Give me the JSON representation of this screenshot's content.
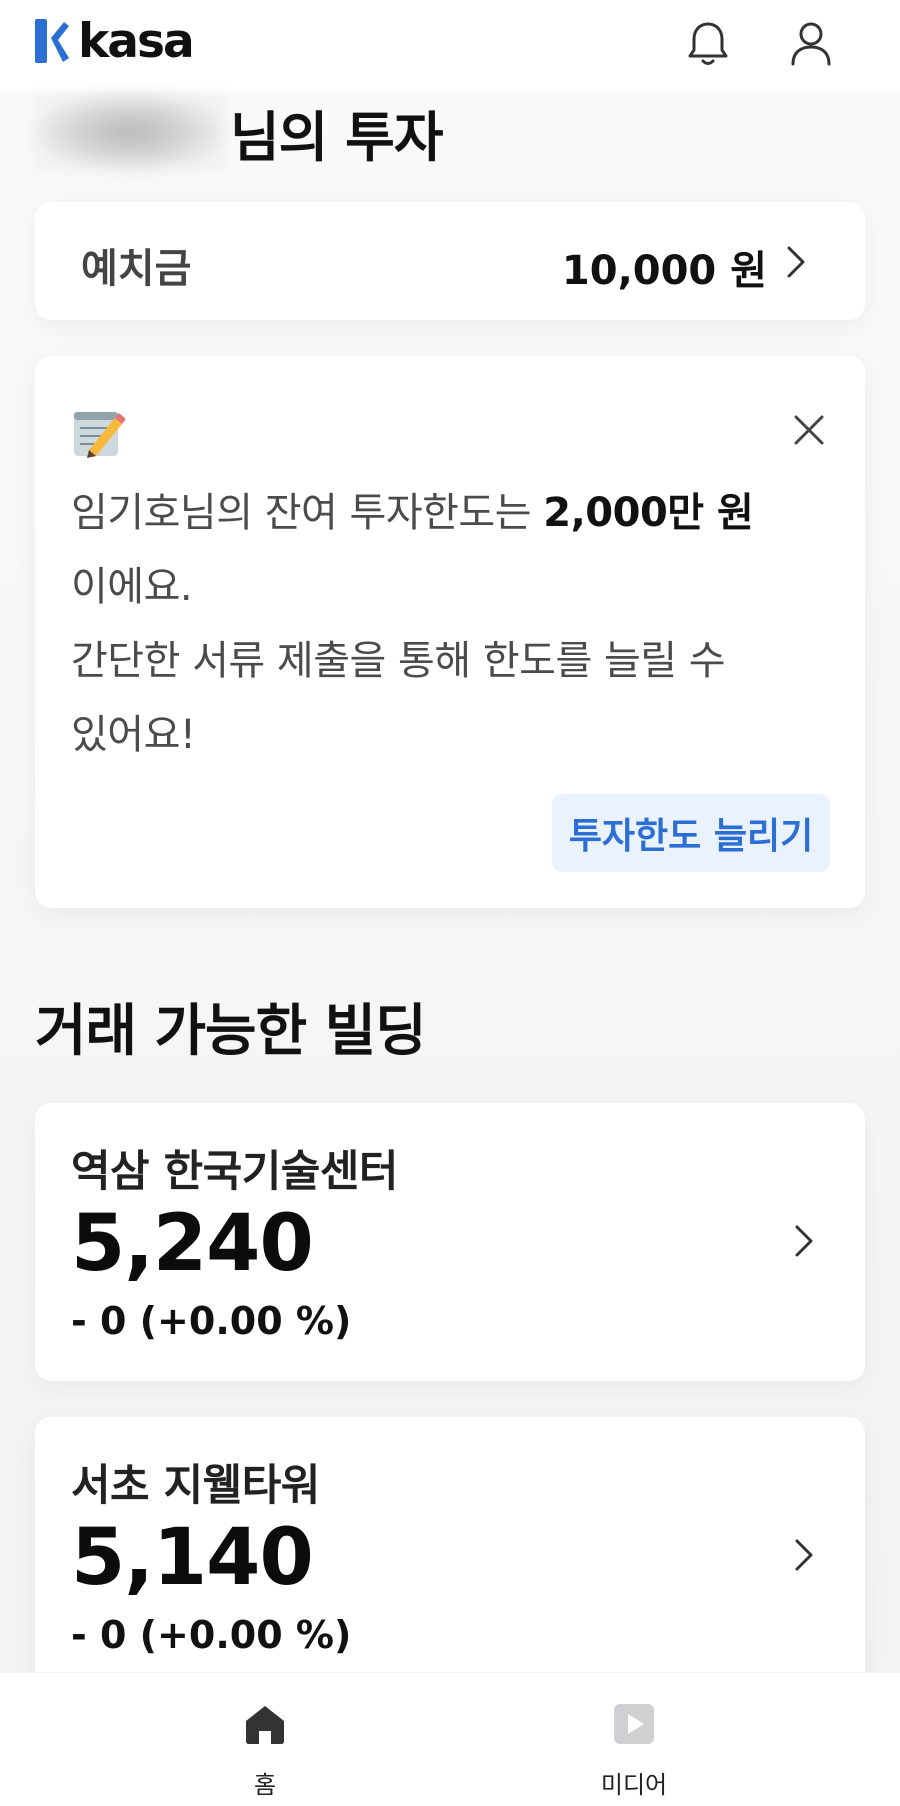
{
  "header": {
    "app_name": "kasa",
    "icons": {
      "notifications": "bell-icon",
      "profile": "user-icon"
    }
  },
  "greeting": {
    "suffix": "님의 투자"
  },
  "deposit": {
    "label": "예치금",
    "value": "10,000 원"
  },
  "notice": {
    "icon": "memo-icon",
    "line1_prefix": "임기호님의 잔여 투자한도는 ",
    "line1_bold": "2,000만 원",
    "line2": "이에요.",
    "line3": "간단한 서류 제출을 통해 한도를 늘릴 수",
    "line4": "있어요!",
    "button_label": "투자한도 늘리기"
  },
  "section": {
    "title": "거래 가능한 빌딩"
  },
  "buildings": [
    {
      "name": "역삼 한국기술센터",
      "price": "5,240",
      "change": "- 0 (+0.00 %)"
    },
    {
      "name": "서초 지웰타워",
      "price": "5,140",
      "change": "- 0 (+0.00 %)"
    }
  ],
  "bottom_nav": [
    {
      "label": "홈",
      "icon": "home-icon"
    },
    {
      "label": "미디어",
      "icon": "media-play-icon"
    }
  ],
  "colors": {
    "brand": "#2b6fd4",
    "button_bg": "#eaf2fd",
    "text_primary": "#111111",
    "text_secondary": "#4b4b4b"
  }
}
